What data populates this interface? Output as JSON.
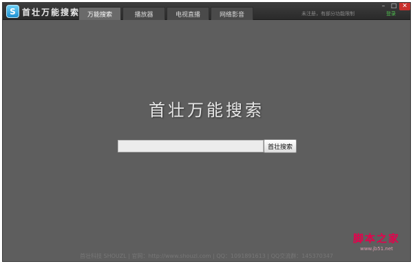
{
  "app": {
    "logo_glyph": "S",
    "name": "首壮万能搜索"
  },
  "tabs": [
    {
      "label": "万能搜索",
      "active": true
    },
    {
      "label": "播放器",
      "active": false
    },
    {
      "label": "电视直播",
      "active": false
    },
    {
      "label": "网络影音",
      "active": false
    }
  ],
  "titlebar": {
    "status_text": "未注册，有部分功能限制",
    "login_label": "登录",
    "minimize_glyph": "–",
    "maximize_glyph": "□",
    "close_glyph": "✕"
  },
  "main": {
    "title": "首壮万能搜索",
    "search_value": "",
    "search_button_label": "首壮搜索"
  },
  "footer": {
    "text": "首壮科技 SHOUZL | 官网：http://www.shouzl.com | QQ：1091891613 | QQ交流群：145370347"
  },
  "watermark": {
    "main": "脚本之家",
    "sub": "www.jb51.net"
  },
  "colors": {
    "background": "#5e5e5e",
    "titlebar": "#2f2f2f",
    "active_tab": "#6a6a6a",
    "login_link": "#4fbf4f",
    "close_button": "#c9302c",
    "watermark": "#e6004c"
  }
}
